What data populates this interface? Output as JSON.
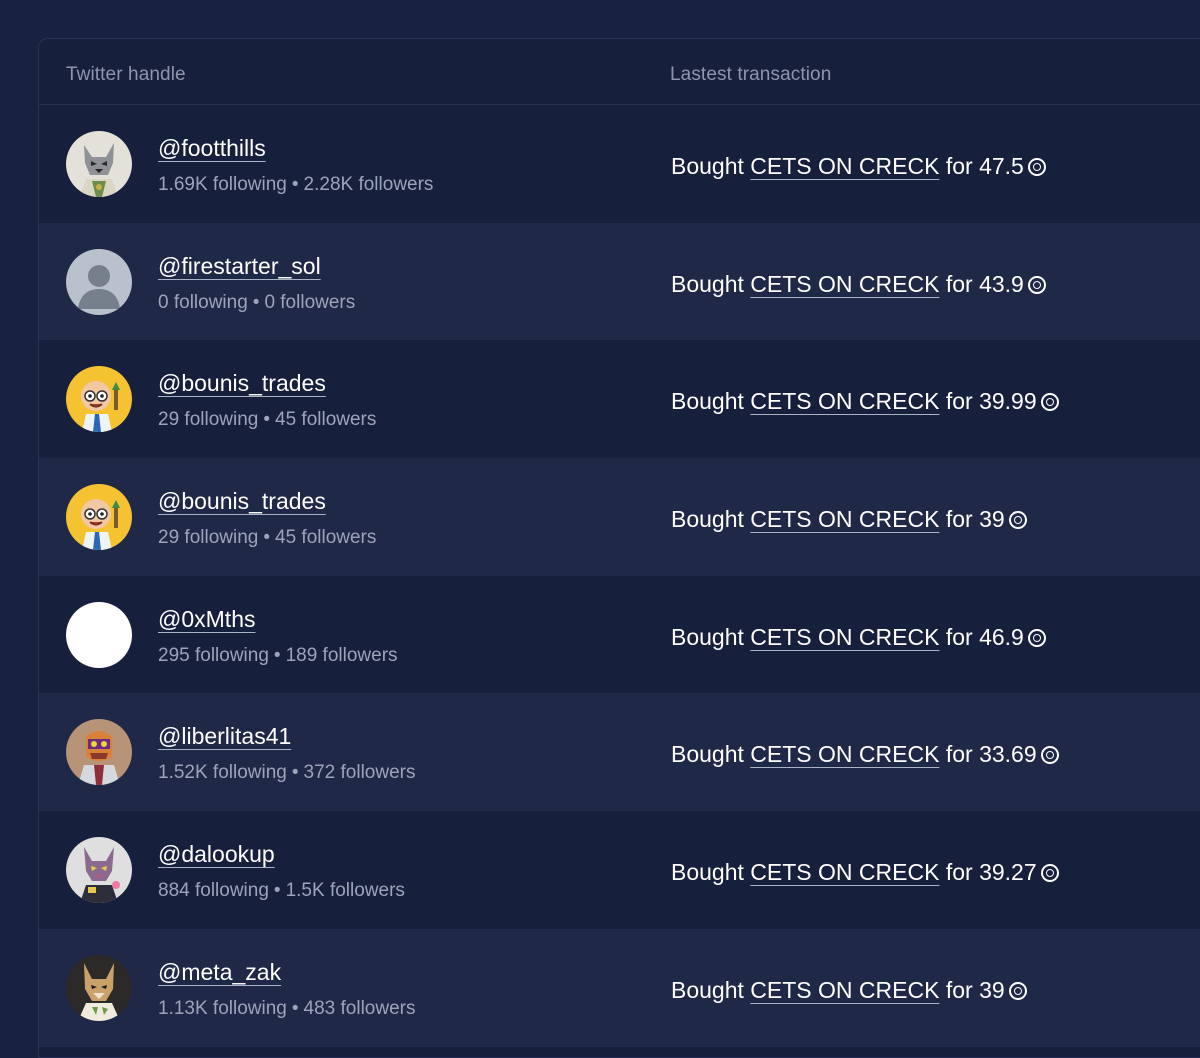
{
  "table": {
    "headers": {
      "handle": "Twitter handle",
      "transaction": "Lastest transaction"
    },
    "rows": [
      {
        "avatar": "grey-wolf-avatar",
        "handle": "@footthills",
        "following": "1.69K following",
        "followers": "2.28K followers",
        "tx_prefix": "Bought",
        "token": "CETS ON CRECK",
        "tx_mid": "for",
        "amount": "47.5"
      },
      {
        "avatar": "default-user-avatar",
        "handle": "@firestarter_sol",
        "following": "0 following",
        "followers": "0 followers",
        "tx_prefix": "Bought",
        "token": "CETS ON CRECK",
        "tx_mid": "for",
        "amount": "43.9"
      },
      {
        "avatar": "cartoon-trader-avatar",
        "handle": "@bounis_trades",
        "following": "29 following",
        "followers": "45 followers",
        "tx_prefix": "Bought",
        "token": "CETS ON CRECK",
        "tx_mid": "for",
        "amount": "39.99"
      },
      {
        "avatar": "cartoon-trader-avatar",
        "handle": "@bounis_trades",
        "following": "29 following",
        "followers": "45 followers",
        "tx_prefix": "Bought",
        "token": "CETS ON CRECK",
        "tx_mid": "for",
        "amount": "39"
      },
      {
        "avatar": "blank-white-avatar",
        "handle": "@0xMths",
        "following": "295 following",
        "followers": "189 followers",
        "tx_prefix": "Bought",
        "token": "CETS ON CRECK",
        "tx_mid": "for",
        "amount": "46.9"
      },
      {
        "avatar": "robot-avatar",
        "handle": "@liberlitas41",
        "following": "1.52K following",
        "followers": "372 followers",
        "tx_prefix": "Bought",
        "token": "CETS ON CRECK",
        "tx_mid": "for",
        "amount": "33.69"
      },
      {
        "avatar": "purple-cat-avatar",
        "handle": "@dalookup",
        "following": "884 following",
        "followers": "1.5K followers",
        "tx_prefix": "Bought",
        "token": "CETS ON CRECK",
        "tx_mid": "for",
        "amount": "39.27"
      },
      {
        "avatar": "fox-avatar",
        "handle": "@meta_zak",
        "following": "1.13K following",
        "followers": "483 followers",
        "tx_prefix": "Bought",
        "token": "CETS ON CRECK",
        "tx_mid": "for",
        "amount": "39"
      }
    ],
    "separator": "•"
  },
  "colors": {
    "background": "#18213f",
    "row": "#161f3c",
    "row_alt": "#1f2947",
    "text": "#ffffff",
    "muted": "#9ca4ba"
  }
}
